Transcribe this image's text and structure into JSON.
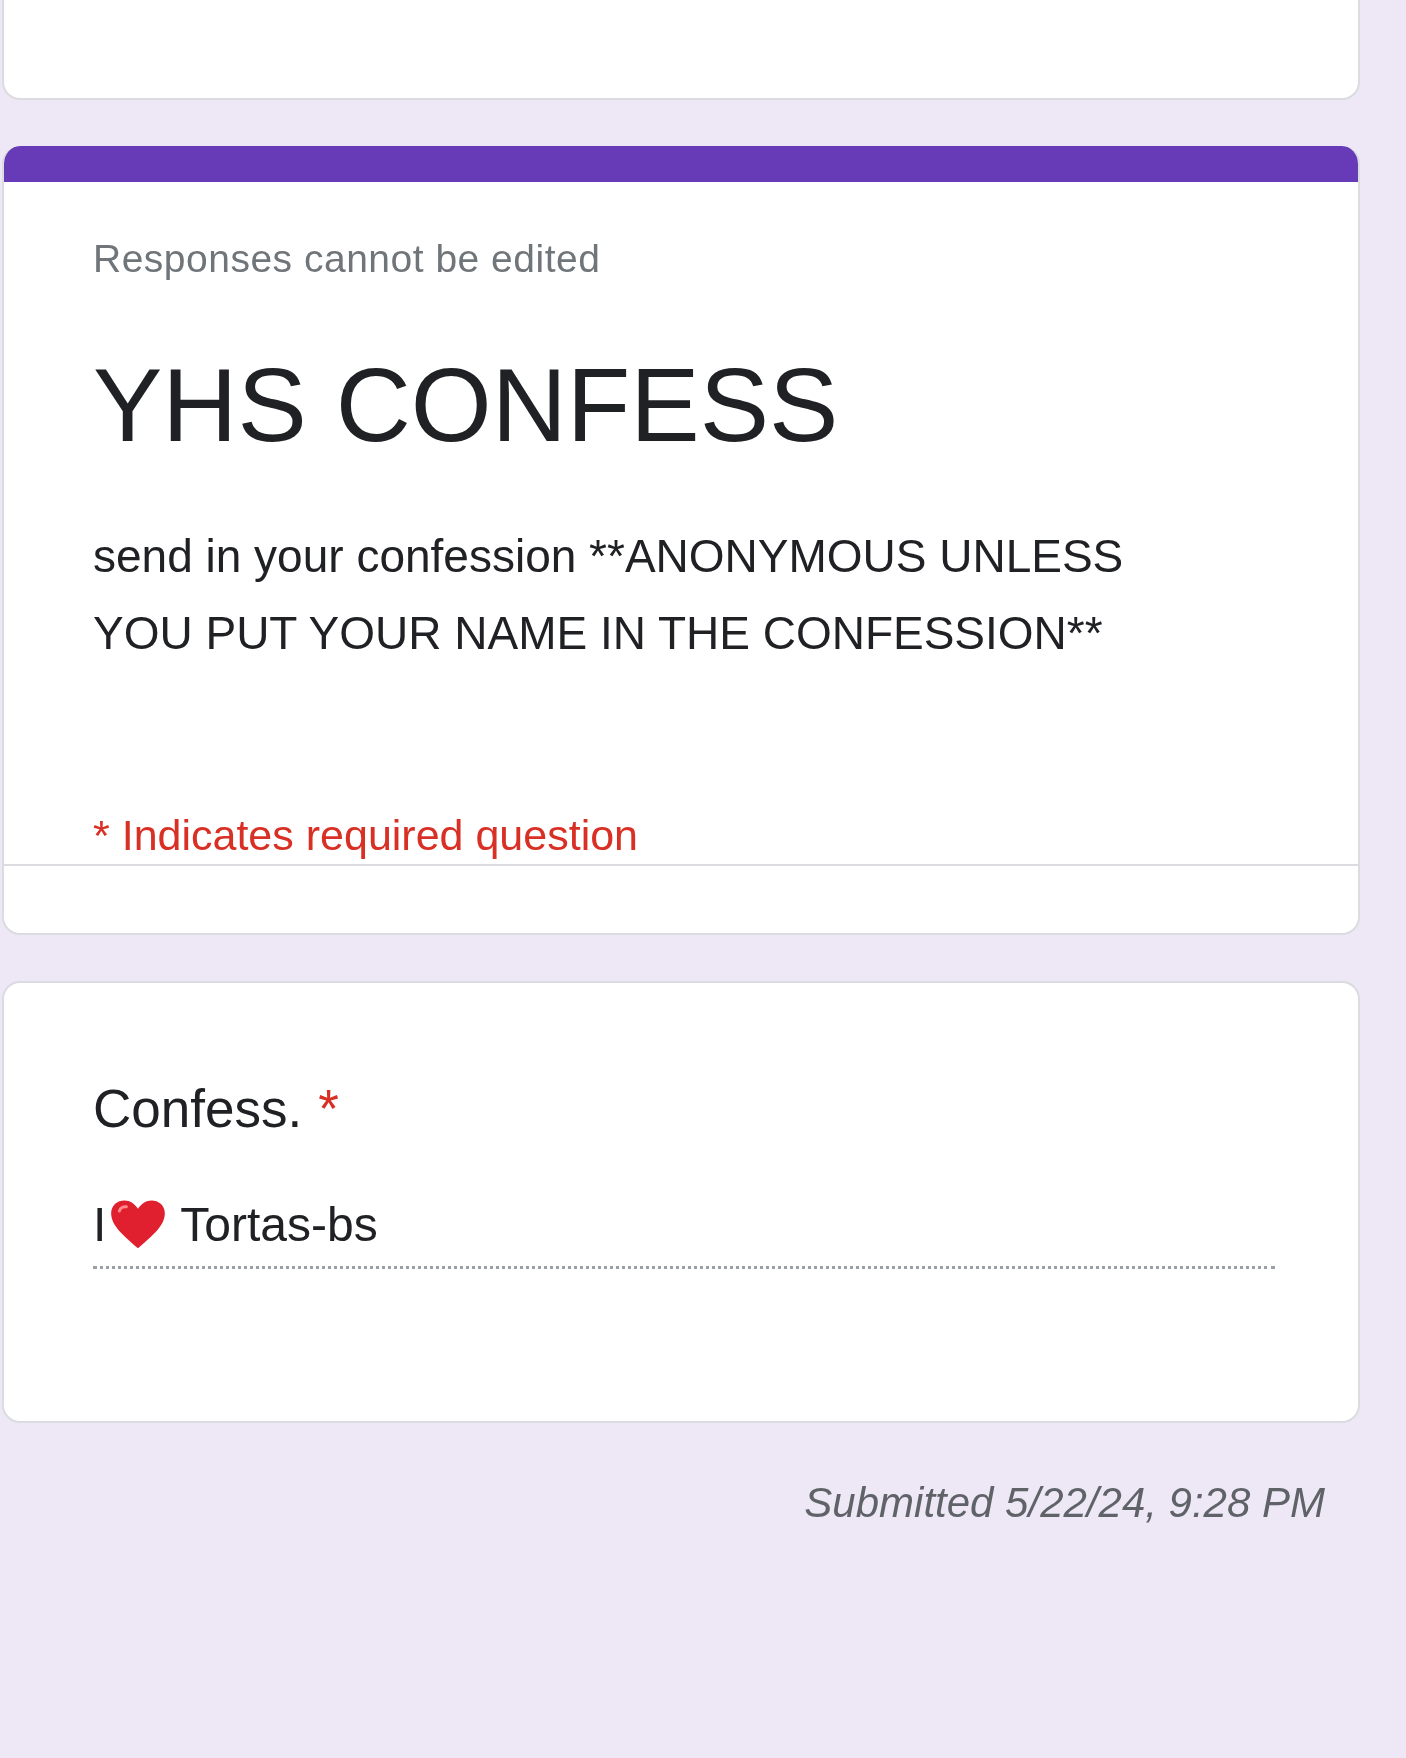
{
  "header_card": {
    "notice": "Responses cannot be edited",
    "title": "YHS CONFESS",
    "description": "send in your confession **ANONYMOUS UNLESS YOU PUT YOUR NAME IN THE CONFESSION**",
    "required_note": "* Indicates required question"
  },
  "question": {
    "label": "Confess.",
    "required_mark": "*",
    "answer_before": "I",
    "answer_after": "Tortas-bs"
  },
  "submitted": "Submitted 5/22/24, 9:28 PM"
}
